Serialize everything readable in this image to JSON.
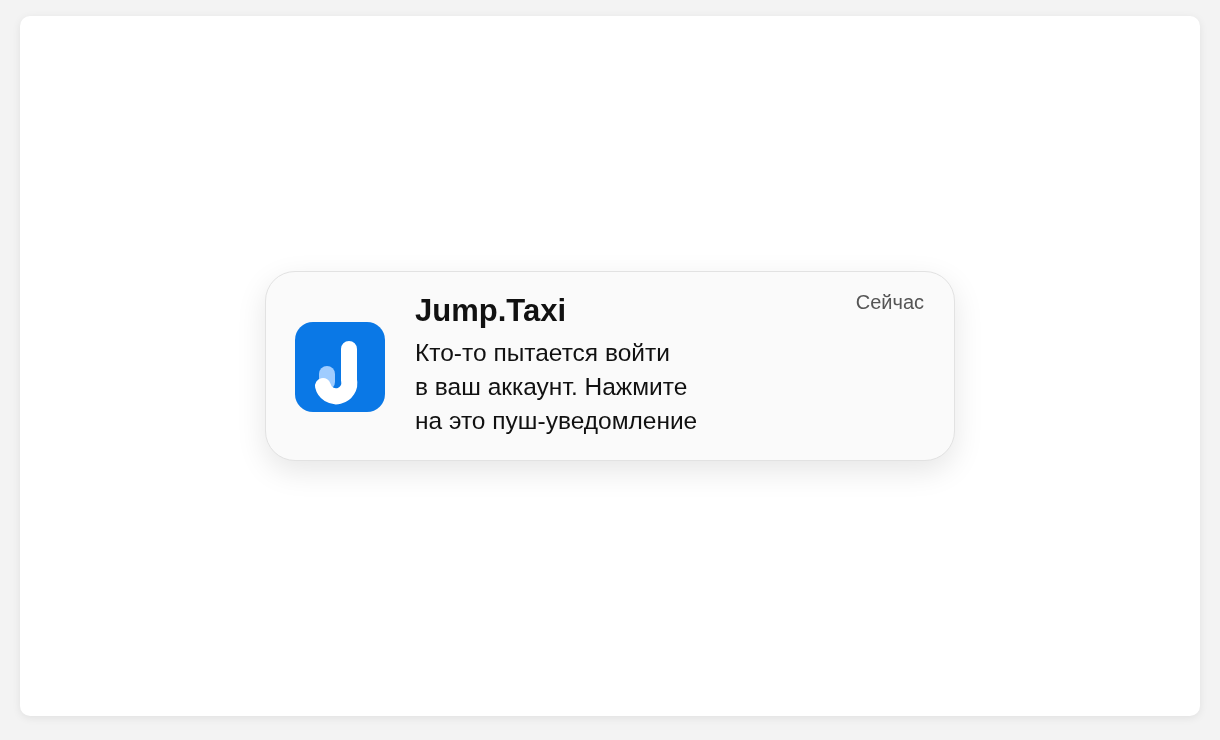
{
  "notification": {
    "app_name": "Jump.Taxi",
    "time": "Сейчас",
    "message": "Кто-то пытается войти\nв ваш аккаунт. Нажмите\nна это пуш-уведомление"
  }
}
